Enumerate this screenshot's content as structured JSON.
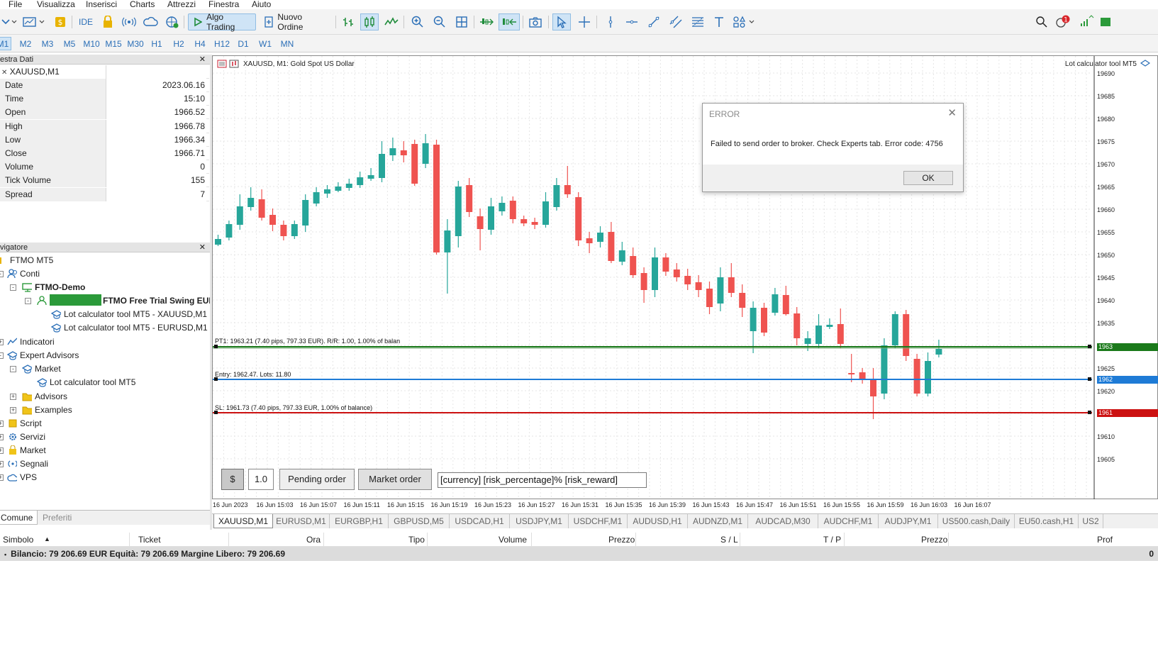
{
  "menu": [
    "File",
    "Visualizza",
    "Inserisci",
    "Charts",
    "Attrezzi",
    "Finestra",
    "Aiuto"
  ],
  "toolbar": {
    "ide_label": "IDE",
    "algo_trading_label": "Algo Trading",
    "new_order_label": "Nuovo Ordine",
    "notification_count": "1"
  },
  "timeframes": [
    "M1",
    "M2",
    "M3",
    "M5",
    "M10",
    "M15",
    "M30",
    "H1",
    "H2",
    "H4",
    "H12",
    "D1",
    "W1",
    "MN"
  ],
  "active_timeframe": "M1",
  "data_window": {
    "title": "estra Dati",
    "symbol": "XAUUSD,M1",
    "rows": [
      {
        "label": "Date",
        "value": "2023.06.16"
      },
      {
        "label": "Time",
        "value": "15:10"
      },
      {
        "label": "Open",
        "value": "1966.52"
      },
      {
        "label": "High",
        "value": "1966.78"
      },
      {
        "label": "Low",
        "value": "1966.34"
      },
      {
        "label": "Close",
        "value": "1966.71"
      },
      {
        "label": "Volume",
        "value": "0"
      },
      {
        "label": "Tick Volume",
        "value": "155"
      },
      {
        "label": "Spread",
        "value": "7"
      }
    ]
  },
  "navigator": {
    "title": "vigatore",
    "root": "FTMO MT5",
    "accounts_label": "Conti",
    "server": "FTMO-Demo",
    "account_name": "FTMO Free Trial Swing EUR",
    "ea_instance_1": "Lot calculator tool MT5 - XAUUSD,M1",
    "ea_instance_2": "Lot calculator tool MT5 - EURUSD,M1",
    "indicators": "Indicatori",
    "expert_advisors": "Expert Advisors",
    "market": "Market",
    "market_ea": "Lot calculator tool MT5",
    "advisors": "Advisors",
    "examples": "Examples",
    "scripts": "Script",
    "services": "Servizi",
    "market_root": "Market",
    "signals": "Segnali",
    "vps": "VPS"
  },
  "left_tabs": [
    "Comune",
    "Preferiti"
  ],
  "chart": {
    "title": "XAUUSD, M1:  Gold Spot US Dollar",
    "ea_label": "Lot calculator tool MT5",
    "tp_text": "PT1: 1963.21 (7.40 pips, 797.33 EUR). R/R: 1.00, 1.00% of balan",
    "entry_text": "Entry: 1962.47. Lots: 11.80",
    "sl_text": "SL: 1961.73 (7.40 pips, 797.33 EUR, 1.00% of balance)",
    "tp_tag": "1963",
    "entry_tag": "1962",
    "sl_tag": "1961",
    "colors": {
      "bull": "#26a69a",
      "bear": "#ef5350",
      "tp": "#1b7a1b",
      "entry": "#1e7bd6",
      "sl": "#cc1111"
    },
    "price_labels": [
      "19690",
      "19685",
      "19680",
      "19675",
      "19670",
      "19665",
      "19660",
      "19655",
      "19650",
      "19645",
      "19640",
      "19635",
      "19630",
      "19625",
      "19620",
      "19615",
      "19610",
      "19605"
    ],
    "time_labels": [
      "16 Jun 2023",
      "16 Jun 15:03",
      "16 Jun 15:07",
      "16 Jun 15:11",
      "16 Jun 15:15",
      "16 Jun 15:19",
      "16 Jun 15:23",
      "16 Jun 15:27",
      "16 Jun 15:31",
      "16 Jun 15:35",
      "16 Jun 15:39",
      "16 Jun 15:43",
      "16 Jun 15:47",
      "16 Jun 15:51",
      "16 Jun 15:55",
      "16 Jun 15:59",
      "16 Jun 16:03",
      "16 Jun 16:07"
    ],
    "controls": {
      "currency_btn": "$",
      "lots_value": "1.0",
      "pending_btn": "Pending order",
      "market_btn": "Market order",
      "template_value": "[currency] [risk_percentage]% [risk_reward]"
    }
  },
  "chart_tabs": [
    "XAUUSD,M1",
    "EURUSD,M1",
    "EURGBP,H1",
    "GBPUSD,M5",
    "USDCAD,H1",
    "USDJPY,M1",
    "USDCHF,M1",
    "AUDUSD,H1",
    "AUDNZD,M1",
    "AUDCAD,M30",
    "AUDCHF,M1",
    "AUDJPY,M1",
    "US500.cash,Daily",
    "EU50.cash,H1",
    "US2"
  ],
  "trade_columns": [
    "Simbolo",
    "Ticket",
    "Ora",
    "Tipo",
    "Volume",
    "Prezzo",
    "S / L",
    "T / P",
    "Prezzo",
    "Prof"
  ],
  "balance_text": "Bilancio: 79 206.69 EUR  Equità: 79 206.69  Margine Libero: 79 206.69",
  "balance_right": "0",
  "dialog": {
    "title": "ERROR",
    "message": "Failed to send order to broker. Check Experts tab. Error code: 4756",
    "ok_label": "OK"
  }
}
